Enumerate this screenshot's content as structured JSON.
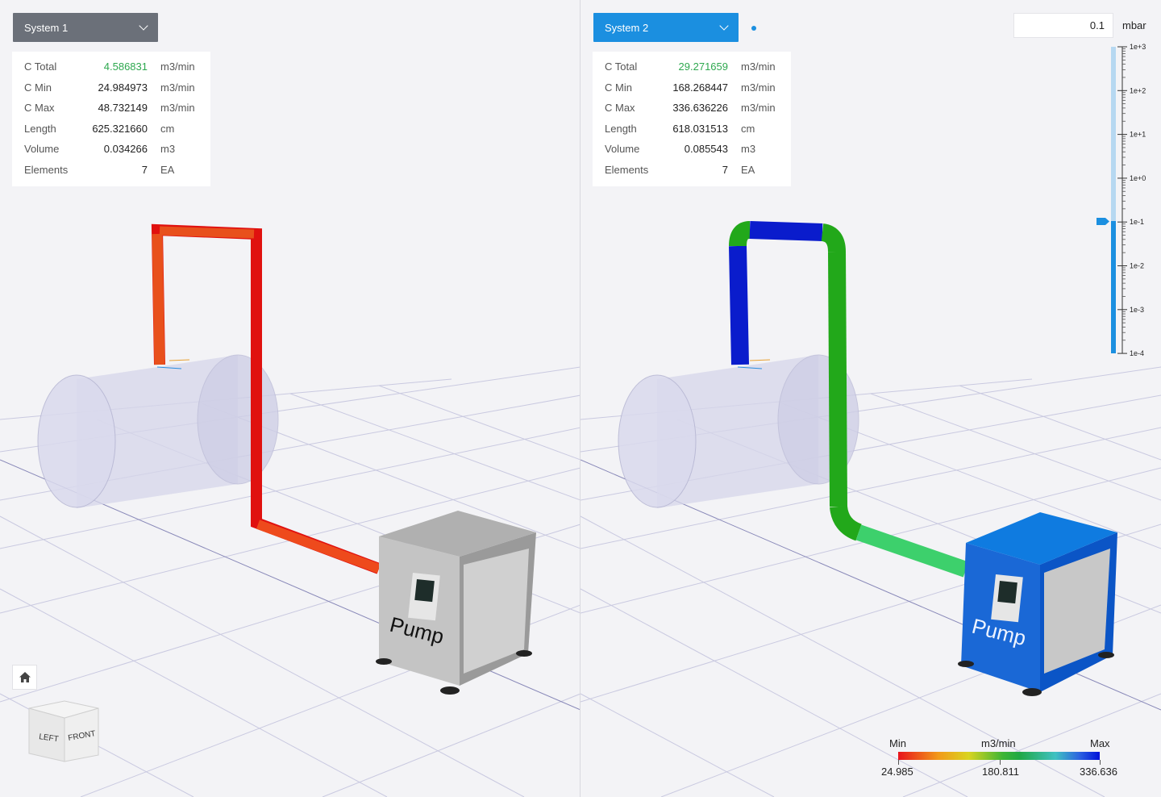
{
  "left": {
    "system_select": "System 1",
    "stats": [
      {
        "label": "C Total",
        "value": "4.586831",
        "unit": "m3/min"
      },
      {
        "label": "C Min",
        "value": "24.984973",
        "unit": "m3/min"
      },
      {
        "label": "C Max",
        "value": "48.732149",
        "unit": "m3/min"
      },
      {
        "label": "Length",
        "value": "625.321660",
        "unit": "cm"
      },
      {
        "label": "Volume",
        "value": "0.034266",
        "unit": "m3"
      },
      {
        "label": "Elements",
        "value": "7",
        "unit": "EA"
      }
    ],
    "pump_label": "Pump",
    "viewcube": {
      "left": "LEFT",
      "front": "FRONT"
    },
    "colors": {
      "pipe_vertical": "#e0110f",
      "pipe_top": "#e8501c",
      "pump_body": "#c8c8c8"
    }
  },
  "right": {
    "system_select": "System 2",
    "stats": [
      {
        "label": "C Total",
        "value": "29.271659",
        "unit": "m3/min"
      },
      {
        "label": "C Min",
        "value": "168.268447",
        "unit": "m3/min"
      },
      {
        "label": "C Max",
        "value": "336.636226",
        "unit": "m3/min"
      },
      {
        "label": "Length",
        "value": "618.031513",
        "unit": "cm"
      },
      {
        "label": "Volume",
        "value": "0.085543",
        "unit": "m3"
      },
      {
        "label": "Elements",
        "value": "7",
        "unit": "EA"
      }
    ],
    "pump_label": "Pump",
    "pressure": {
      "value": "0.1",
      "unit": "mbar"
    },
    "scale_ticks": [
      "1e+3",
      "1e+2",
      "1e+1",
      "1e+0",
      "1e-1",
      "1e-2",
      "1e-3",
      "1e-4"
    ],
    "legend": {
      "min_label": "Min",
      "unit_label": "m3/min",
      "max_label": "Max",
      "min_value": "24.985",
      "mid_value": "180.811",
      "max_value": "336.636"
    },
    "colors": {
      "accent": "#1b8fe0",
      "pipe_blue": "#0a1ccc",
      "pipe_green": "#22a81a",
      "pump_body": "#0a5fd0"
    }
  }
}
